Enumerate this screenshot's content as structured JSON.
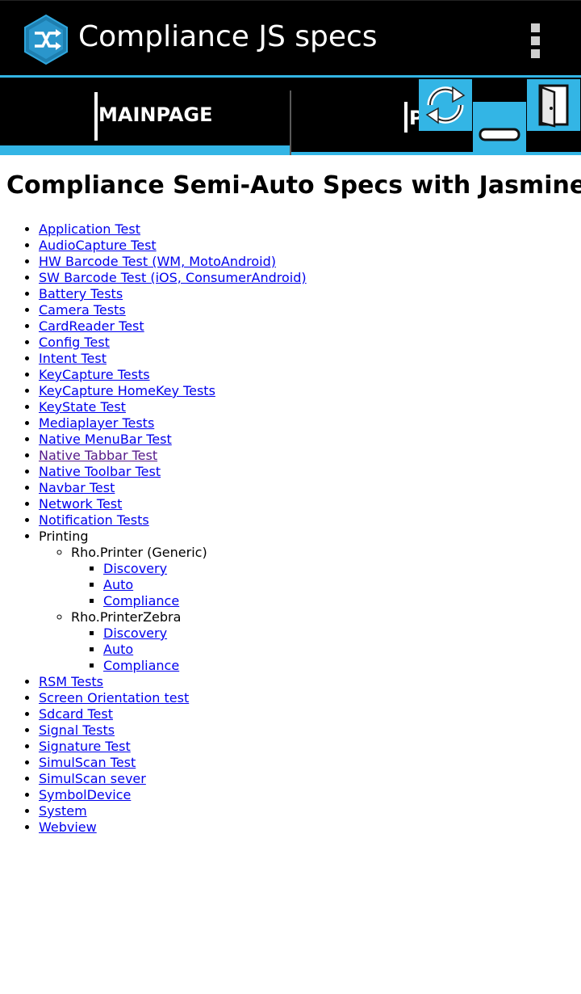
{
  "app": {
    "title": "Compliance JS specs"
  },
  "tabs": [
    {
      "label": "MAINPAGE",
      "selected": true
    },
    {
      "label": "P",
      "selected": false
    }
  ],
  "toolbar_icons": [
    "sync-icon",
    "minimize-icon",
    "exit-door-icon"
  ],
  "page": {
    "title": "Compliance Semi-Auto Specs with Jasmine"
  },
  "list": {
    "items_before_printing": [
      "Application Test",
      "AudioCapture Test",
      "HW Barcode Test (WM, MotoAndroid)",
      "SW Barcode Test (iOS, ConsumerAndroid)",
      "Battery Tests",
      "Camera Tests",
      "CardReader Test",
      "Config Test",
      "Intent Test",
      "KeyCapture Tests",
      "KeyCapture HomeKey Tests",
      "KeyState Test",
      "Mediaplayer Tests",
      "Native MenuBar Test",
      "Native Tabbar Test",
      "Native Toolbar Test",
      "Navbar Test",
      "Network Test",
      "Notification Tests"
    ],
    "printing": {
      "label": "Printing",
      "groups": [
        {
          "label": "Rho.Printer (Generic)",
          "links": [
            "Discovery",
            "Auto",
            "Compliance"
          ]
        },
        {
          "label": "Rho.PrinterZebra",
          "links": [
            "Discovery",
            "Auto",
            "Compliance"
          ]
        }
      ]
    },
    "items_after_printing": [
      "RSM Tests",
      "Screen Orientation test",
      "Sdcard Test",
      "Signal Tests",
      "Signature Test",
      "SimulScan Test",
      "SimulScan sever",
      "SymbolDevice",
      "System",
      "Webview"
    ]
  },
  "colors": {
    "accent": "#33b5e5",
    "link": "#0000ee",
    "visited_link": "#551a8b",
    "actionbar_bg": "#000000"
  }
}
